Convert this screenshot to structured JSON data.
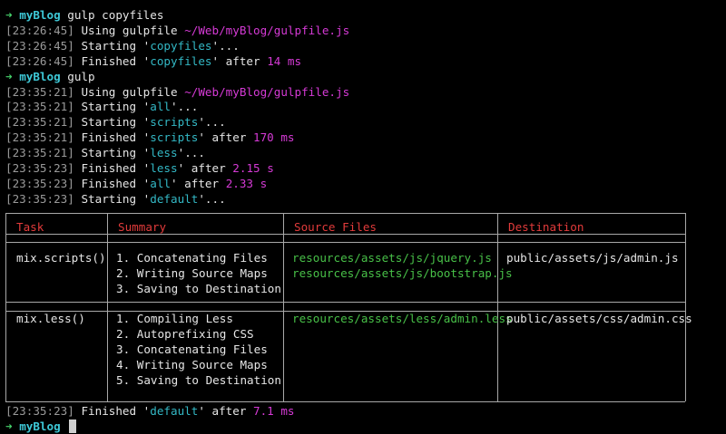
{
  "prompt_arrow": "➜",
  "prompt_dir": "myBlog",
  "runs": [
    {
      "command": " gulp copyfiles",
      "logs": [
        {
          "ts": "23:26:45",
          "parts": [
            [
              "white",
              " Using gulpfile "
            ],
            [
              "mag",
              "~/Web/myBlog/gulpfile.js"
            ]
          ]
        },
        {
          "ts": "23:26:45",
          "parts": [
            [
              "white",
              " Starting '"
            ],
            [
              "task",
              "copyfiles"
            ],
            [
              "white",
              "'..."
            ]
          ]
        },
        {
          "ts": "23:26:45",
          "parts": [
            [
              "white",
              " Finished '"
            ],
            [
              "task",
              "copyfiles"
            ],
            [
              "white",
              "' after "
            ],
            [
              "mag",
              "14 ms"
            ]
          ]
        }
      ]
    },
    {
      "command": " gulp",
      "logs": [
        {
          "ts": "23:35:21",
          "parts": [
            [
              "white",
              " Using gulpfile "
            ],
            [
              "mag",
              "~/Web/myBlog/gulpfile.js"
            ]
          ]
        },
        {
          "ts": "23:35:21",
          "parts": [
            [
              "white",
              " Starting '"
            ],
            [
              "task",
              "all"
            ],
            [
              "white",
              "'..."
            ]
          ]
        },
        {
          "ts": "23:35:21",
          "parts": [
            [
              "white",
              " Starting '"
            ],
            [
              "task",
              "scripts"
            ],
            [
              "white",
              "'..."
            ]
          ]
        },
        {
          "ts": "23:35:21",
          "parts": [
            [
              "white",
              " Finished '"
            ],
            [
              "task",
              "scripts"
            ],
            [
              "white",
              "' after "
            ],
            [
              "mag",
              "170 ms"
            ]
          ]
        },
        {
          "ts": "23:35:21",
          "parts": [
            [
              "white",
              " Starting '"
            ],
            [
              "task",
              "less"
            ],
            [
              "white",
              "'..."
            ]
          ]
        },
        {
          "ts": "23:35:23",
          "parts": [
            [
              "white",
              " Finished '"
            ],
            [
              "task",
              "less"
            ],
            [
              "white",
              "' after "
            ],
            [
              "mag",
              "2.15 s"
            ]
          ]
        },
        {
          "ts": "23:35:23",
          "parts": [
            [
              "white",
              " Finished '"
            ],
            [
              "task",
              "all"
            ],
            [
              "white",
              "' after "
            ],
            [
              "mag",
              "2.33 s"
            ]
          ]
        },
        {
          "ts": "23:35:23",
          "parts": [
            [
              "white",
              " Starting '"
            ],
            [
              "task",
              "default"
            ],
            [
              "white",
              "'..."
            ]
          ]
        }
      ]
    }
  ],
  "table": {
    "headers": [
      "Task",
      "Summary",
      "Source Files",
      "Destination"
    ],
    "rows": [
      {
        "task": "mix.scripts()",
        "summary": [
          "1. Concatenating Files",
          "2. Writing Source Maps",
          "3. Saving to Destination"
        ],
        "sources": [
          "resources/assets/js/jquery.js",
          "resources/assets/js/bootstrap.js"
        ],
        "destination": "public/assets/js/admin.js"
      },
      {
        "task": "mix.less()",
        "summary": [
          "1. Compiling Less",
          "2. Autoprefixing CSS",
          "3. Concatenating Files",
          "4. Writing Source Maps",
          "5. Saving to Destination"
        ],
        "sources": [
          "resources/assets/less/admin.less"
        ],
        "destination": "public/assets/css/admin.css"
      }
    ]
  },
  "final_log": {
    "ts": "23:35:23",
    "parts": [
      [
        "white",
        " Finished '"
      ],
      [
        "task",
        "default"
      ],
      [
        "white",
        "' after "
      ],
      [
        "mag",
        "7.1 ms"
      ]
    ]
  },
  "colors": {
    "background": "#000000",
    "prompt_arrow": "#45d06a",
    "prompt_dir": "#3ec9d8",
    "task_name": "#33b8c5",
    "value": "#d63ad6",
    "source_path": "#48c048",
    "table_header": "#e23b3b",
    "timestamp": "#9a9a9a"
  }
}
